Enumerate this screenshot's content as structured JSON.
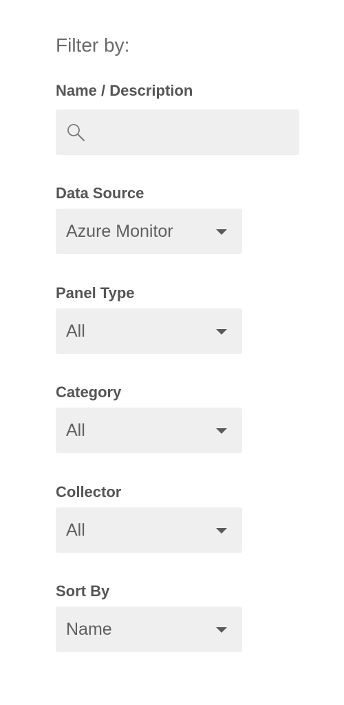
{
  "filters": {
    "heading": "Filter by:",
    "name_description": {
      "label": "Name / Description",
      "value": "",
      "icon": "search-icon"
    },
    "data_source": {
      "label": "Data Source",
      "value": "Azure Monitor"
    },
    "panel_type": {
      "label": "Panel Type",
      "value": "All"
    },
    "category": {
      "label": "Category",
      "value": "All"
    },
    "collector": {
      "label": "Collector",
      "value": "All"
    },
    "sort_by": {
      "label": "Sort By",
      "value": "Name"
    }
  }
}
